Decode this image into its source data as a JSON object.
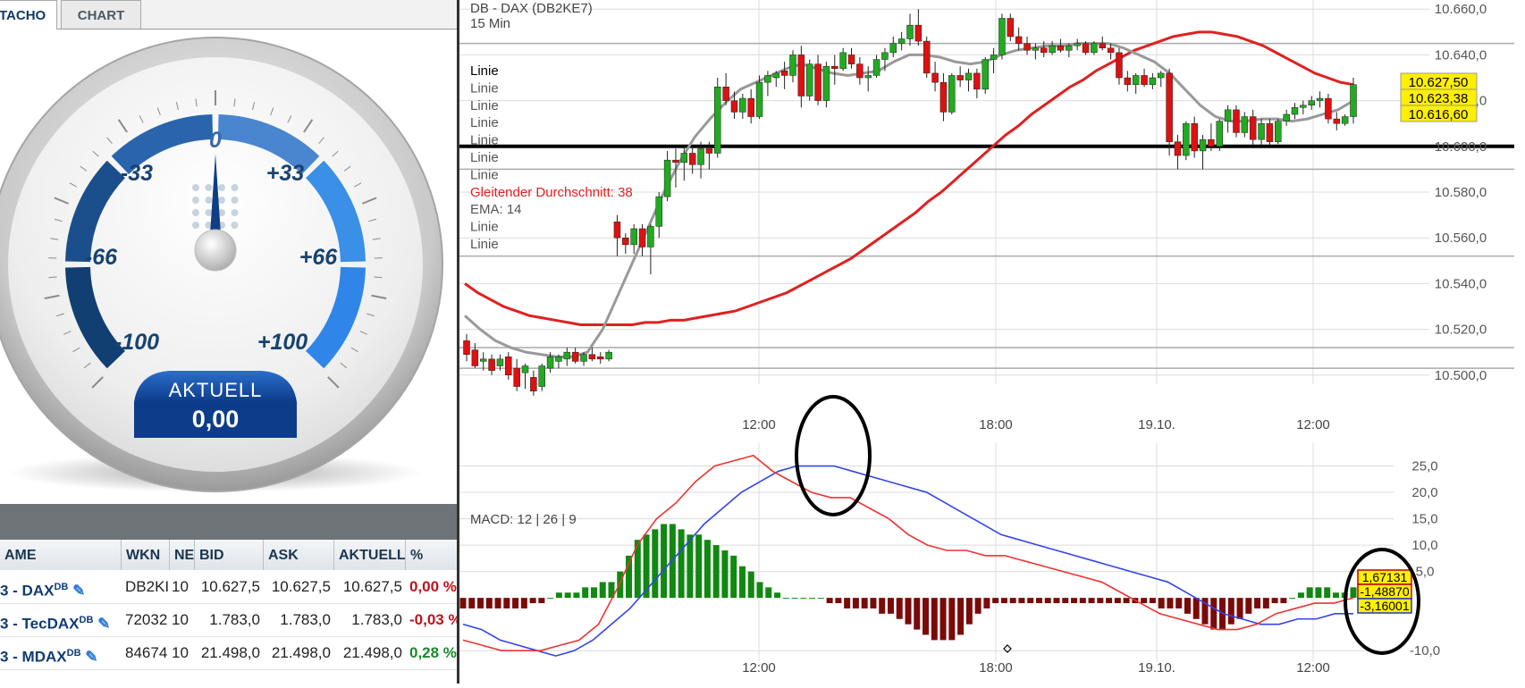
{
  "tabs": [
    {
      "label": "TACHO",
      "active": true
    },
    {
      "label": "CHART",
      "active": false
    }
  ],
  "gauge": {
    "scale_labels": [
      "-100",
      "-66",
      "-33",
      "0",
      "+33",
      "+66",
      "+100"
    ],
    "current_label": "AKTUELL",
    "current_value": "0,00",
    "needle_value": 0
  },
  "table": {
    "headers": [
      "AME",
      "WKN",
      "NE",
      "BID",
      "ASK",
      "AKTUELL",
      "%"
    ],
    "rows": [
      {
        "name": "3 - DAX",
        "sup": "DB",
        "wkn": "DB2KI",
        "ne": "10",
        "bid": "10.627,5",
        "ask": "10.627,5",
        "aktuell": "10.627,5",
        "pct": "0,00 %",
        "pct_color": "#c0121a"
      },
      {
        "name": "3 - TecDAX",
        "sup": "DB",
        "wkn": "72032",
        "ne": "10",
        "bid": "1.783,0",
        "ask": "1.783,0",
        "aktuell": "1.783,0",
        "pct": "-0,03 %",
        "pct_color": "#c0121a"
      },
      {
        "name": "3 - MDAX",
        "sup": "DB",
        "wkn": "84674",
        "ne": "10",
        "bid": "21.498,0",
        "ask": "21.498,0",
        "aktuell": "21.498,0",
        "pct": "0,28 %",
        "pct_color": "#1a8a2a"
      }
    ]
  },
  "chart": {
    "title": "DB - DAX (DB2KE7)",
    "interval": "15 Min",
    "legend": [
      {
        "text": "Linie",
        "color": "#000000"
      },
      {
        "text": "Linie",
        "color": "#555555"
      },
      {
        "text": "Linie",
        "color": "#555555"
      },
      {
        "text": "Linie",
        "color": "#555555"
      },
      {
        "text": "Linie",
        "color": "#555555"
      },
      {
        "text": "Linie",
        "color": "#555555"
      },
      {
        "text": "Linie",
        "color": "#555555"
      },
      {
        "text": "Gleitender Durchschnitt: 38",
        "color": "#e02020"
      },
      {
        "text": "EMA: 14",
        "color": "#555555"
      },
      {
        "text": "Linie",
        "color": "#555555"
      },
      {
        "text": "Linie",
        "color": "#555555"
      }
    ],
    "price_ticks": [
      "10.660,0",
      "10.640,0",
      "10.620,0",
      "10.600,0",
      "10.580,0",
      "10.560,0",
      "10.540,0",
      "10.520,0",
      "10.500,0"
    ],
    "price_tick_values": [
      10660,
      10640,
      10620,
      10600,
      10580,
      10560,
      10540,
      10520,
      10500
    ],
    "price_badges": [
      {
        "text": "10.627,50"
      },
      {
        "text": "10.623,38"
      },
      {
        "text": "10.616,60"
      }
    ],
    "time_labels": [
      "12:00",
      "18:00",
      "19.10.",
      "12:00"
    ],
    "macd_label": "MACD: 12 | 26 | 9",
    "macd_ticks": [
      "25,0",
      "20,0",
      "15,0",
      "10,0",
      "5,0",
      "-10,0"
    ],
    "macd_badges": [
      {
        "text": "1,67131",
        "fill": "#ffef00",
        "stroke": "#c00000"
      },
      {
        "text": "-1,48870",
        "fill": "#ffef00",
        "stroke": "#c00000"
      },
      {
        "text": "-3,16001",
        "fill": "#ffef00",
        "stroke": "#1a3cc0"
      }
    ],
    "colors": {
      "up": "#22aa22",
      "down": "#dd1111",
      "ma38": "#e02020",
      "ema14": "#999999",
      "macd_line": "#3344ee",
      "signal_line": "#ee3333",
      "hist_pos": "#118811",
      "hist_neg": "#7a0a0a"
    },
    "horizontal_levels": [
      10600,
      10590,
      10552,
      10512,
      10503,
      10645
    ],
    "candles": [
      {
        "o": 10515,
        "h": 10518,
        "l": 10506,
        "c": 10509
      },
      {
        "o": 10511,
        "h": 10514,
        "l": 10503,
        "c": 10504
      },
      {
        "o": 10506,
        "h": 10510,
        "l": 10502,
        "c": 10507
      },
      {
        "o": 10507,
        "h": 10509,
        "l": 10500,
        "c": 10502
      },
      {
        "o": 10504,
        "h": 10509,
        "l": 10502,
        "c": 10507
      },
      {
        "o": 10508,
        "h": 10510,
        "l": 10498,
        "c": 10500
      },
      {
        "o": 10503,
        "h": 10507,
        "l": 10493,
        "c": 10495
      },
      {
        "o": 10501,
        "h": 10505,
        "l": 10494,
        "c": 10504
      },
      {
        "o": 10499,
        "h": 10502,
        "l": 10491,
        "c": 10493
      },
      {
        "o": 10495,
        "h": 10505,
        "l": 10493,
        "c": 10504
      },
      {
        "o": 10503,
        "h": 10510,
        "l": 10501,
        "c": 10508
      },
      {
        "o": 10506,
        "h": 10509,
        "l": 10503,
        "c": 10508
      },
      {
        "o": 10507,
        "h": 10512,
        "l": 10504,
        "c": 10510
      },
      {
        "o": 10510,
        "h": 10512,
        "l": 10505,
        "c": 10506
      },
      {
        "o": 10506,
        "h": 10510,
        "l": 10504,
        "c": 10509
      },
      {
        "o": 10509,
        "h": 10512,
        "l": 10506,
        "c": 10507
      },
      {
        "o": 10508,
        "h": 10510,
        "l": 10505,
        "c": 10507
      },
      {
        "o": 10507,
        "h": 10511,
        "l": 10506,
        "c": 10510
      },
      {
        "o": 10567,
        "h": 10570,
        "l": 10552,
        "c": 10560
      },
      {
        "o": 10560,
        "h": 10562,
        "l": 10553,
        "c": 10557
      },
      {
        "o": 10557,
        "h": 10566,
        "l": 10553,
        "c": 10564
      },
      {
        "o": 10564,
        "h": 10566,
        "l": 10552,
        "c": 10556
      },
      {
        "o": 10556,
        "h": 10566,
        "l": 10544,
        "c": 10565
      },
      {
        "o": 10565,
        "h": 10580,
        "l": 10560,
        "c": 10578
      },
      {
        "o": 10578,
        "h": 10598,
        "l": 10576,
        "c": 10594
      },
      {
        "o": 10594,
        "h": 10599,
        "l": 10582,
        "c": 10593
      },
      {
        "o": 10593,
        "h": 10600,
        "l": 10585,
        "c": 10597
      },
      {
        "o": 10597,
        "h": 10600,
        "l": 10588,
        "c": 10592
      },
      {
        "o": 10592,
        "h": 10602,
        "l": 10586,
        "c": 10599
      },
      {
        "o": 10599,
        "h": 10602,
        "l": 10590,
        "c": 10597
      },
      {
        "o": 10597,
        "h": 10630,
        "l": 10595,
        "c": 10626
      },
      {
        "o": 10626,
        "h": 10632,
        "l": 10618,
        "c": 10620
      },
      {
        "o": 10620,
        "h": 10624,
        "l": 10612,
        "c": 10615
      },
      {
        "o": 10615,
        "h": 10623,
        "l": 10612,
        "c": 10621
      },
      {
        "o": 10621,
        "h": 10625,
        "l": 10610,
        "c": 10613
      },
      {
        "o": 10613,
        "h": 10631,
        "l": 10612,
        "c": 10628
      },
      {
        "o": 10628,
        "h": 10633,
        "l": 10622,
        "c": 10631
      },
      {
        "o": 10630,
        "h": 10633,
        "l": 10626,
        "c": 10632
      },
      {
        "o": 10633,
        "h": 10637,
        "l": 10625,
        "c": 10631
      },
      {
        "o": 10631,
        "h": 10642,
        "l": 10628,
        "c": 10640
      },
      {
        "o": 10640,
        "h": 10644,
        "l": 10617,
        "c": 10622
      },
      {
        "o": 10622,
        "h": 10638,
        "l": 10620,
        "c": 10636
      },
      {
        "o": 10636,
        "h": 10640,
        "l": 10618,
        "c": 10620
      },
      {
        "o": 10620,
        "h": 10637,
        "l": 10617,
        "c": 10635
      },
      {
        "o": 10635,
        "h": 10640,
        "l": 10627,
        "c": 10634
      },
      {
        "o": 10634,
        "h": 10643,
        "l": 10633,
        "c": 10641
      },
      {
        "o": 10640,
        "h": 10643,
        "l": 10634,
        "c": 10636
      },
      {
        "o": 10636,
        "h": 10639,
        "l": 10627,
        "c": 10630
      },
      {
        "o": 10630,
        "h": 10635,
        "l": 10624,
        "c": 10631
      },
      {
        "o": 10631,
        "h": 10640,
        "l": 10630,
        "c": 10638
      },
      {
        "o": 10638,
        "h": 10643,
        "l": 10633,
        "c": 10641
      },
      {
        "o": 10641,
        "h": 10648,
        "l": 10639,
        "c": 10645
      },
      {
        "o": 10645,
        "h": 10650,
        "l": 10642,
        "c": 10647
      },
      {
        "o": 10647,
        "h": 10658,
        "l": 10644,
        "c": 10653
      },
      {
        "o": 10653,
        "h": 10660,
        "l": 10644,
        "c": 10646
      },
      {
        "o": 10646,
        "h": 10648,
        "l": 10630,
        "c": 10632
      },
      {
        "o": 10632,
        "h": 10637,
        "l": 10624,
        "c": 10628
      },
      {
        "o": 10628,
        "h": 10632,
        "l": 10611,
        "c": 10615
      },
      {
        "o": 10615,
        "h": 10632,
        "l": 10614,
        "c": 10631
      },
      {
        "o": 10631,
        "h": 10635,
        "l": 10626,
        "c": 10629
      },
      {
        "o": 10629,
        "h": 10634,
        "l": 10624,
        "c": 10632
      },
      {
        "o": 10632,
        "h": 10634,
        "l": 10621,
        "c": 10625
      },
      {
        "o": 10625,
        "h": 10639,
        "l": 10623,
        "c": 10638
      },
      {
        "o": 10638,
        "h": 10643,
        "l": 10632,
        "c": 10640
      },
      {
        "o": 10640,
        "h": 10658,
        "l": 10638,
        "c": 10656
      },
      {
        "o": 10656,
        "h": 10658,
        "l": 10646,
        "c": 10648
      },
      {
        "o": 10648,
        "h": 10652,
        "l": 10642,
        "c": 10645
      },
      {
        "o": 10645,
        "h": 10648,
        "l": 10640,
        "c": 10642
      },
      {
        "o": 10642,
        "h": 10645,
        "l": 10638,
        "c": 10643
      },
      {
        "o": 10643,
        "h": 10646,
        "l": 10639,
        "c": 10641
      },
      {
        "o": 10641,
        "h": 10646,
        "l": 10640,
        "c": 10644
      },
      {
        "o": 10644,
        "h": 10647,
        "l": 10641,
        "c": 10642
      },
      {
        "o": 10642,
        "h": 10645,
        "l": 10639,
        "c": 10644
      },
      {
        "o": 10644,
        "h": 10647,
        "l": 10642,
        "c": 10645
      },
      {
        "o": 10645,
        "h": 10646,
        "l": 10640,
        "c": 10641
      },
      {
        "o": 10641,
        "h": 10646,
        "l": 10640,
        "c": 10645
      },
      {
        "o": 10645,
        "h": 10648,
        "l": 10642,
        "c": 10643
      },
      {
        "o": 10643,
        "h": 10645,
        "l": 10638,
        "c": 10641
      },
      {
        "o": 10641,
        "h": 10643,
        "l": 10627,
        "c": 10630
      },
      {
        "o": 10630,
        "h": 10633,
        "l": 10624,
        "c": 10627
      },
      {
        "o": 10627,
        "h": 10632,
        "l": 10623,
        "c": 10631
      },
      {
        "o": 10631,
        "h": 10634,
        "l": 10626,
        "c": 10627
      },
      {
        "o": 10627,
        "h": 10632,
        "l": 10625,
        "c": 10630
      },
      {
        "o": 10630,
        "h": 10633,
        "l": 10626,
        "c": 10632
      },
      {
        "o": 10632,
        "h": 10634,
        "l": 10596,
        "c": 10602
      },
      {
        "o": 10602,
        "h": 10605,
        "l": 10590,
        "c": 10596
      },
      {
        "o": 10596,
        "h": 10611,
        "l": 10594,
        "c": 10610
      },
      {
        "o": 10610,
        "h": 10613,
        "l": 10595,
        "c": 10598
      },
      {
        "o": 10598,
        "h": 10605,
        "l": 10590,
        "c": 10603
      },
      {
        "o": 10603,
        "h": 10610,
        "l": 10598,
        "c": 10600
      },
      {
        "o": 10600,
        "h": 10612,
        "l": 10598,
        "c": 10611
      },
      {
        "o": 10611,
        "h": 10618,
        "l": 10606,
        "c": 10616
      },
      {
        "o": 10616,
        "h": 10618,
        "l": 10604,
        "c": 10606
      },
      {
        "o": 10606,
        "h": 10615,
        "l": 10604,
        "c": 10613
      },
      {
        "o": 10613,
        "h": 10616,
        "l": 10600,
        "c": 10603
      },
      {
        "o": 10603,
        "h": 10612,
        "l": 10600,
        "c": 10610
      },
      {
        "o": 10610,
        "h": 10612,
        "l": 10600,
        "c": 10602
      },
      {
        "o": 10602,
        "h": 10612,
        "l": 10601,
        "c": 10611
      },
      {
        "o": 10611,
        "h": 10616,
        "l": 10609,
        "c": 10614
      },
      {
        "o": 10614,
        "h": 10619,
        "l": 10612,
        "c": 10617
      },
      {
        "o": 10617,
        "h": 10620,
        "l": 10614,
        "c": 10618
      },
      {
        "o": 10618,
        "h": 10622,
        "l": 10616,
        "c": 10620
      },
      {
        "o": 10620,
        "h": 10624,
        "l": 10617,
        "c": 10621
      },
      {
        "o": 10621,
        "h": 10623,
        "l": 10610,
        "c": 10612
      },
      {
        "o": 10612,
        "h": 10615,
        "l": 10607,
        "c": 10610
      },
      {
        "o": 10610,
        "h": 10614,
        "l": 10609,
        "c": 10613
      },
      {
        "o": 10613,
        "h": 10630,
        "l": 10610,
        "c": 10627
      }
    ],
    "ma38": [
      10540,
      10536,
      10533,
      10530,
      10528,
      10526,
      10525,
      10524,
      10523,
      10522,
      10522,
      10522,
      10522,
      10522,
      10523,
      10523,
      10524,
      10524,
      10525,
      10526,
      10527,
      10528,
      10530,
      10532,
      10534,
      10536,
      10539,
      10542,
      10545,
      10548,
      10551,
      10555,
      10559,
      10563,
      10567,
      10571,
      10576,
      10580,
      10585,
      10590,
      10595,
      10600,
      10605,
      10609,
      10614,
      10618,
      10622,
      10626,
      10629,
      10633,
      10636,
      10639,
      10642,
      10644,
      10646,
      10648,
      10649,
      10650,
      10650,
      10649,
      10648,
      10646,
      10644,
      10641,
      10638,
      10635,
      10632,
      10630,
      10628,
      10627
    ],
    "ema14": [
      10526,
      10520,
      10515,
      10512,
      10510,
      10509,
      10508,
      10508,
      10510,
      10520,
      10535,
      10550,
      10565,
      10580,
      10593,
      10604,
      10612,
      10619,
      10625,
      10628,
      10631,
      10634,
      10636,
      10634,
      10632,
      10631,
      10632,
      10633,
      10637,
      10640,
      10640,
      10639,
      10637,
      10636,
      10637,
      10640,
      10642,
      10643,
      10644,
      10644,
      10645,
      10645,
      10645,
      10643,
      10640,
      10637,
      10632,
      10625,
      10618,
      10613,
      10611,
      10611,
      10612,
      10612,
      10611,
      10612,
      10614,
      10616,
      10620
    ],
    "macd": {
      "range": [
        -12,
        30
      ],
      "histogram": [
        -2,
        -2,
        -2,
        -2,
        -2,
        -2,
        -2,
        -2,
        -1,
        -1,
        0,
        1,
        1,
        1,
        2,
        2,
        3,
        3,
        5,
        8,
        11,
        12,
        13,
        14,
        14,
        13,
        12,
        12,
        11,
        10,
        9,
        8,
        6,
        5,
        3,
        2,
        1,
        0,
        0,
        0,
        0,
        0,
        -1,
        -1,
        -2,
        -2,
        -2,
        -2,
        -3,
        -3,
        -4,
        -5,
        -6,
        -7,
        -8,
        -8,
        -8,
        -7,
        -5,
        -3,
        -2,
        -1,
        -1,
        -1,
        -1,
        -1,
        -1,
        -1,
        -1,
        -1,
        -1,
        -1,
        -1,
        -1,
        -1,
        -1,
        -1,
        -1,
        -1,
        -1,
        -2,
        -2,
        -2,
        -3,
        -4,
        -5,
        -6,
        -6,
        -5,
        -4,
        -3,
        -2,
        -2,
        -1,
        -1,
        0,
        1,
        2,
        2,
        2,
        1,
        1,
        2
      ],
      "macd_line": [
        -5,
        -6,
        -8,
        -9,
        -10,
        -11,
        -10,
        -8,
        -5,
        -2,
        2,
        6,
        10,
        14,
        17,
        20,
        22,
        24,
        25,
        25,
        25,
        24,
        23,
        22,
        21,
        20,
        18,
        16,
        14,
        12,
        11,
        10,
        9,
        8,
        7,
        6,
        5,
        4,
        3,
        1,
        -1,
        -3,
        -4,
        -5,
        -5,
        -4,
        -4,
        -3,
        -3
      ],
      "signal_line": [
        -8,
        -9,
        -10,
        -10,
        -10,
        -9,
        -8,
        -5,
        2,
        10,
        15,
        18,
        22,
        25,
        26,
        27,
        24,
        22,
        20,
        19,
        19,
        17,
        15,
        12,
        10,
        9,
        9,
        8,
        8,
        7,
        6,
        5,
        4,
        3,
        1,
        -1,
        -3,
        -4,
        -5,
        -6,
        -6,
        -5,
        -3,
        -2,
        -1,
        -1,
        0
      ]
    }
  }
}
